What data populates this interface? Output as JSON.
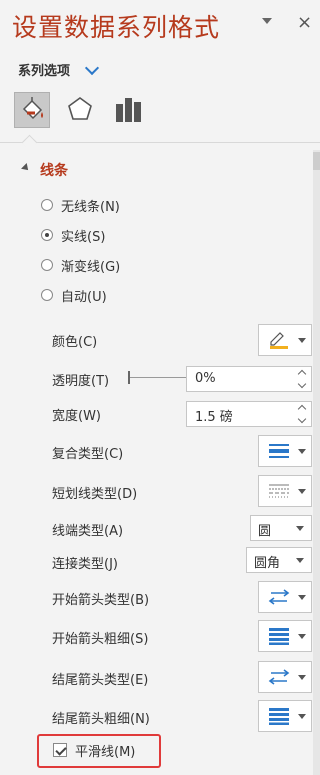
{
  "pane": {
    "title": "设置数据系列格式",
    "close_glyph": "×"
  },
  "series_options": {
    "label": "系列选项"
  },
  "section": {
    "label": "线条"
  },
  "line_type_options": [
    {
      "label": "无线条(N)",
      "selected": false
    },
    {
      "label": "实线(S)",
      "selected": true
    },
    {
      "label": "渐变线(G)",
      "selected": false
    },
    {
      "label": "自动(U)",
      "selected": false
    }
  ],
  "properties": {
    "color": {
      "label": "颜色(C)",
      "accent": "#f2b01e"
    },
    "transparency": {
      "label": "透明度(T)",
      "value": "0%"
    },
    "width": {
      "label": "宽度(W)",
      "value": "1.5 磅"
    },
    "compound_type": {
      "label": "复合类型(C)"
    },
    "dash_type": {
      "label": "短划线类型(D)"
    },
    "cap_type": {
      "label": "线端类型(A)",
      "value": "圆"
    },
    "join_type": {
      "label": "连接类型(J)",
      "value": "圆角"
    },
    "begin_arrow_type": {
      "label": "开始箭头类型(B)"
    },
    "begin_arrow_size": {
      "label": "开始箭头粗细(S)"
    },
    "end_arrow_type": {
      "label": "结尾箭头类型(E)"
    },
    "end_arrow_size": {
      "label": "结尾箭头粗细(N)"
    }
  },
  "smoothed_line": {
    "label": "平滑线(M)",
    "checked": true
  },
  "colors": {
    "title_accent": "#b63a1d",
    "icon_blue": "#2b78c9",
    "highlight_box": "#e03a3a"
  }
}
